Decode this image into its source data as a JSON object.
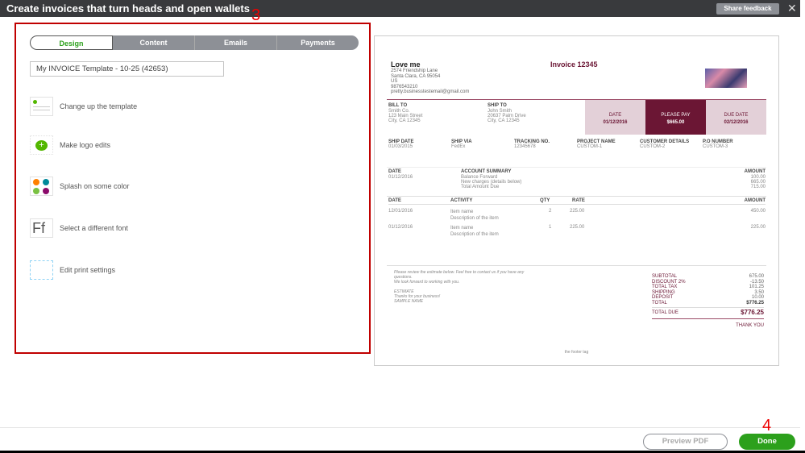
{
  "header": {
    "title": "Create invoices that turn heads and open wallets",
    "share_feedback": "Share feedback",
    "close_icon": "close-icon"
  },
  "annotations": {
    "a3": "3",
    "a4": "4"
  },
  "tabs": [
    {
      "label": "Design"
    },
    {
      "label": "Content"
    },
    {
      "label": "Emails"
    },
    {
      "label": "Payments"
    }
  ],
  "template_name": "My INVOICE Template - 10-25 (42653)",
  "options": [
    {
      "label": "Change up the template",
      "icon": "template-icon"
    },
    {
      "label": "Make logo edits",
      "icon": "logo-add-icon"
    },
    {
      "label": "Splash on some color",
      "icon": "color-palette-icon"
    },
    {
      "label": "Select a different font",
      "icon": "font-icon"
    },
    {
      "label": "Edit print settings",
      "icon": "print-settings-icon"
    }
  ],
  "invoice": {
    "company": "Love me",
    "address": [
      "2574 Friendship Lane",
      "Santa Clara, CA 95054",
      "US",
      "9876543210",
      "pretty.businesstestemail@gmail.com"
    ],
    "title": "Invoice 12345",
    "bill_to_label": "BILL TO",
    "bill_to": [
      "Smith Co.",
      "123 Main Street",
      "City, CA 12345"
    ],
    "ship_to_label": "SHIP TO",
    "ship_to": [
      "John Smith",
      "20637 Palm Drive",
      "City, CA 12345"
    ],
    "date_label": "DATE",
    "date": "01/12/2016",
    "please_pay_label": "PLEASE PAY",
    "please_pay": "$665.00",
    "due_label": "DUE DATE",
    "due": "02/12/2016",
    "meta": [
      {
        "label": "SHIP DATE",
        "value": "01/03/2015"
      },
      {
        "label": "SHIP VIA",
        "value": "FedEx"
      },
      {
        "label": "TRACKING NO.",
        "value": "12345678"
      },
      {
        "label": "PROJECT NAME",
        "value": "CUSTOM-1"
      },
      {
        "label": "CUSTOMER DETAILS",
        "value": "CUSTOM-2"
      },
      {
        "label": "P.O NUMBER",
        "value": "CUSTOM-3"
      }
    ],
    "summary": {
      "h_date": "DATE",
      "h_summary": "ACCOUNT SUMMARY",
      "h_amount": "AMOUNT",
      "date": "01/12/2016",
      "lines": [
        "Balance Forward",
        "New charges (details below)",
        "Total Amount Due"
      ],
      "amounts": [
        "100.00",
        "665.00",
        "715.00"
      ]
    },
    "items_header": {
      "date": "DATE",
      "activity": "ACTIVITY",
      "qty": "QTY",
      "rate": "RATE",
      "amount": "AMOUNT"
    },
    "items": [
      {
        "date": "12/01/2016",
        "name": "Item name",
        "desc": "Description of the item",
        "qty": "2",
        "rate": "225.00",
        "amount": "450.00"
      },
      {
        "date": "01/12/2016",
        "name": "Item name",
        "desc": "Description of the item",
        "qty": "1",
        "rate": "225.00",
        "amount": "225.00"
      }
    ],
    "note": [
      "Please review the estimate below. Feel free to contact us if you have any",
      "questions.",
      "We look forward to working with you."
    ],
    "note2": [
      "ESTIMATE",
      "Thanks for your business!",
      "SAMPLE NAME"
    ],
    "totals": [
      {
        "label": "SUBTOTAL",
        "value": "675.00"
      },
      {
        "label": "DISCOUNT 2%",
        "value": "-13.50"
      },
      {
        "label": "TOTAL TAX",
        "value": "101.25"
      },
      {
        "label": "SHIPPING",
        "value": "3.50"
      },
      {
        "label": "DEPOSIT",
        "value": "10.00"
      },
      {
        "label": "TOTAL",
        "value": "$776.25"
      }
    ],
    "total_due_label": "TOTAL DUE",
    "total_due": "$776.25",
    "thank_you": "THANK YOU",
    "footer": "the footer tag"
  },
  "footer": {
    "preview": "Preview PDF",
    "done": "Done"
  },
  "colors": {
    "accent": "#6b1634",
    "green": "#2ca01c"
  }
}
